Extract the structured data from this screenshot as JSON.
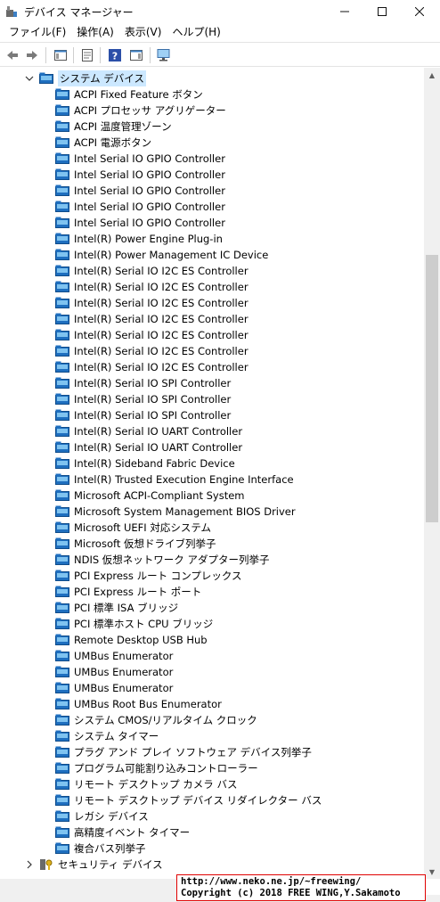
{
  "window": {
    "title": "デバイス マネージャー"
  },
  "menu": [
    "ファイル(F)",
    "操作(A)",
    "表示(V)",
    "ヘルプ(H)"
  ],
  "toolbar_icons": [
    "back-arrow-icon",
    "forward-arrow-icon",
    "console-tree-icon",
    "properties-icon",
    "help-icon",
    "action-pane-icon",
    "monitor-icon"
  ],
  "tree": {
    "category": "システム デバイス",
    "devices": [
      "ACPI Fixed Feature ボタン",
      "ACPI プロセッサ アグリゲーター",
      "ACPI 温度管理ゾーン",
      "ACPI 電源ボタン",
      "Intel Serial IO GPIO Controller",
      "Intel Serial IO GPIO Controller",
      "Intel Serial IO GPIO Controller",
      "Intel Serial IO GPIO Controller",
      "Intel Serial IO GPIO Controller",
      "Intel(R) Power Engine Plug-in",
      "Intel(R) Power Management IC Device",
      "Intel(R) Serial IO I2C ES Controller",
      "Intel(R) Serial IO I2C ES Controller",
      "Intel(R) Serial IO I2C ES Controller",
      "Intel(R) Serial IO I2C ES Controller",
      "Intel(R) Serial IO I2C ES Controller",
      "Intel(R) Serial IO I2C ES Controller",
      "Intel(R) Serial IO I2C ES Controller",
      "Intel(R) Serial IO SPI Controller",
      "Intel(R) Serial IO SPI Controller",
      "Intel(R) Serial IO SPI Controller",
      "Intel(R) Serial IO UART Controller",
      "Intel(R) Serial IO UART Controller",
      "Intel(R) Sideband Fabric Device",
      "Intel(R) Trusted Execution Engine Interface",
      "Microsoft ACPI-Compliant System",
      "Microsoft System Management BIOS Driver",
      "Microsoft UEFI 対応システム",
      "Microsoft 仮想ドライブ列挙子",
      "NDIS 仮想ネットワーク アダプター列挙子",
      "PCI Express ルート コンプレックス",
      "PCI Express ルート ポート",
      "PCI 標準 ISA ブリッジ",
      "PCI 標準ホスト CPU ブリッジ",
      "Remote Desktop USB Hub",
      "UMBus Enumerator",
      "UMBus Enumerator",
      "UMBus Enumerator",
      "UMBus Root Bus Enumerator",
      "システム CMOS/リアルタイム クロック",
      "システム タイマー",
      "プラグ アンド プレイ ソフトウェア デバイス列挙子",
      "プログラム可能割り込みコントローラー",
      "リモート デスクトップ カメラ バス",
      "リモート デスクトップ デバイス リダイレクター バス",
      "レガシ デバイス",
      "高精度イベント タイマー",
      "複合バス列挙子"
    ],
    "next_category": "セキュリティ デバイス"
  },
  "colors": {
    "selection": "#cce8ff",
    "device_icon": "#1f6fbf",
    "watermark_border": "#e00000"
  },
  "watermark": {
    "line1": "http://www.neko.ne.jp/~freewing/",
    "line2": "Copyright (c) 2018 FREE WING,Y.Sakamoto"
  }
}
